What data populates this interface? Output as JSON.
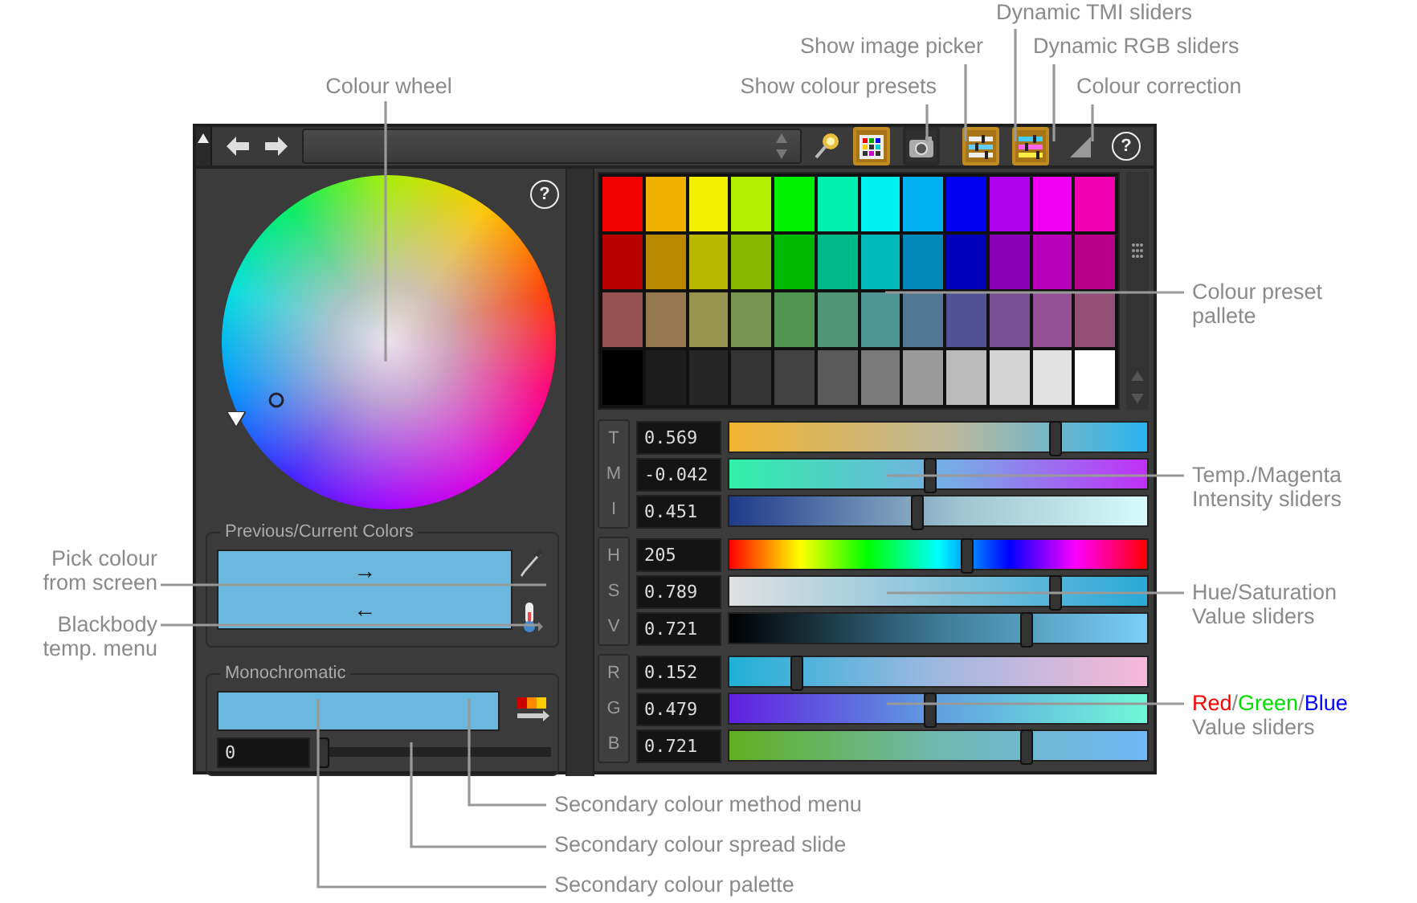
{
  "toolbar": {
    "buttons": [
      {
        "kind": "presets",
        "on": true
      },
      {
        "kind": "picker",
        "on": false
      },
      {
        "kind": "tmi",
        "on": true
      },
      {
        "kind": "rgb",
        "on": true
      },
      {
        "kind": "correction",
        "on": false
      }
    ],
    "help": "?"
  },
  "wheel": {
    "help": "?"
  },
  "previous_current": {
    "title": "Previous/Current Colors",
    "swatches": [
      {
        "color": "#6bb8de",
        "arrow": "→"
      },
      {
        "color": "#6bb8de",
        "arrow": "←"
      }
    ]
  },
  "monochromatic": {
    "title": "Monochromatic",
    "color": "#6bb8de",
    "spread": "0",
    "level": 0
  },
  "palette": [
    {
      "swatches": [
        {
          "color": "#f00000"
        },
        {
          "color": "#f0b000"
        },
        {
          "color": "#f0f000"
        },
        {
          "color": "#b0f000"
        },
        {
          "color": "#00f000"
        },
        {
          "color": "#00f0b0"
        },
        {
          "color": "#00f0f0"
        },
        {
          "color": "#00b0f0"
        },
        {
          "color": "#0000f0"
        },
        {
          "color": "#b000f0"
        },
        {
          "color": "#f000f0"
        },
        {
          "color": "#f000b0"
        }
      ]
    },
    {
      "swatches": [
        {
          "color": "#b80000"
        },
        {
          "color": "#b88800"
        },
        {
          "color": "#b8b800"
        },
        {
          "color": "#88b800"
        },
        {
          "color": "#00b800"
        },
        {
          "color": "#00b888"
        },
        {
          "color": "#00b8b8"
        },
        {
          "color": "#0088b8"
        },
        {
          "color": "#0000b8"
        },
        {
          "color": "#8800b8"
        },
        {
          "color": "#b800b8"
        },
        {
          "color": "#b80088"
        }
      ]
    },
    {
      "swatches": [
        {
          "color": "#955050"
        },
        {
          "color": "#957850"
        },
        {
          "color": "#959550"
        },
        {
          "color": "#789550"
        },
        {
          "color": "#509550"
        },
        {
          "color": "#509578"
        },
        {
          "color": "#509595"
        },
        {
          "color": "#507895"
        },
        {
          "color": "#505095"
        },
        {
          "color": "#785095"
        },
        {
          "color": "#955095"
        },
        {
          "color": "#955078"
        }
      ]
    },
    {
      "swatches": [
        {
          "color": "#000000"
        },
        {
          "color": "#1c1c1c"
        },
        {
          "color": "#262626"
        },
        {
          "color": "#333333"
        },
        {
          "color": "#424242"
        },
        {
          "color": "#5a5a5a"
        },
        {
          "color": "#7a7a7a"
        },
        {
          "color": "#9a9a9a"
        },
        {
          "color": "#bababa"
        },
        {
          "color": "#d4d4d4"
        },
        {
          "color": "#e2e2e2"
        },
        {
          "color": "#ffffff"
        }
      ]
    }
  ],
  "slider_groups": [
    [
      {
        "label": "T",
        "value": "0.569",
        "level": 0.78
      },
      {
        "label": "M",
        "value": "-0.042",
        "level": 0.48
      },
      {
        "label": "I",
        "value": "0.451",
        "level": 0.45
      }
    ],
    [
      {
        "label": "H",
        "value": "205",
        "level": 0.57
      },
      {
        "label": "S",
        "value": "0.789",
        "level": 0.78
      },
      {
        "label": "V",
        "value": "0.721",
        "level": 0.71
      }
    ],
    [
      {
        "label": "R",
        "value": "0.152",
        "level": 0.16
      },
      {
        "label": "G",
        "value": "0.479",
        "level": 0.48
      },
      {
        "label": "B",
        "value": "0.721",
        "level": 0.71
      }
    ]
  ],
  "annotations": {
    "top": [
      {
        "lines": [
          [
            {
              "text": "Dynamic TMI sliders"
            }
          ]
        ]
      },
      {
        "lines": [
          [
            {
              "text": "Show image picker"
            }
          ]
        ]
      },
      {
        "lines": [
          [
            {
              "text": "Dynamic RGB sliders"
            }
          ]
        ]
      },
      {
        "lines": [
          [
            {
              "text": "Colour wheel"
            }
          ]
        ]
      },
      {
        "lines": [
          [
            {
              "text": "Show colour presets"
            }
          ]
        ]
      },
      {
        "lines": [
          [
            {
              "text": "Colour correction"
            }
          ]
        ]
      }
    ],
    "right": [
      {
        "lines": [
          [
            {
              "text": "Colour preset"
            }
          ],
          [
            {
              "text": "pallete"
            }
          ]
        ]
      },
      {
        "lines": [
          [
            {
              "text": "Temp./Magenta"
            }
          ],
          [
            {
              "text": "Intensity sliders"
            }
          ]
        ]
      },
      {
        "lines": [
          [
            {
              "text": "Hue/Saturation"
            }
          ],
          [
            {
              "text": "Value sliders"
            }
          ]
        ]
      },
      {
        "lines": [
          [
            {
              "text": "Red",
              "color": "#ff0000"
            },
            {
              "text": "/"
            },
            {
              "text": "Green",
              "color": "#00e000"
            },
            {
              "text": "/"
            },
            {
              "text": "Blue",
              "color": "#0000ff"
            }
          ],
          [
            {
              "text": "Value sliders"
            }
          ]
        ]
      }
    ],
    "left": [
      {
        "lines": [
          [
            {
              "text": "Pick colour"
            }
          ],
          [
            {
              "text": "from screen"
            }
          ]
        ]
      },
      {
        "lines": [
          [
            {
              "text": "Blackbody"
            }
          ],
          [
            {
              "text": "temp. menu"
            }
          ]
        ]
      }
    ],
    "bottom": [
      {
        "lines": [
          [
            {
              "text": "Secondary colour method menu"
            }
          ]
        ]
      },
      {
        "lines": [
          [
            {
              "text": "Secondary colour spread slide"
            }
          ]
        ]
      },
      {
        "lines": [
          [
            {
              "text": "Secondary colour palette"
            }
          ]
        ]
      }
    ]
  }
}
